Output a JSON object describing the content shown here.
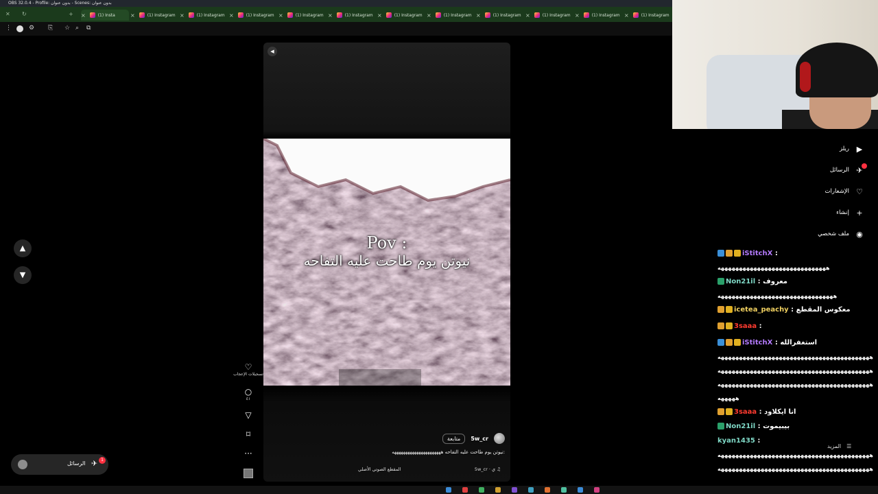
{
  "obs_title": "OBS 32.0.4 - Profile: بدون عنوان - Scenes: بدون عنوان",
  "tabs": [
    {
      "label": "(1) Insta"
    },
    {
      "label": "(1) Instagram"
    },
    {
      "label": "(1) Instagram"
    },
    {
      "label": "(1) Instagram"
    },
    {
      "label": "(1) Instagram"
    },
    {
      "label": "(1) Instagram"
    },
    {
      "label": "(1) Instagram"
    },
    {
      "label": "(1) Instagram"
    },
    {
      "label": "(1) Instagram"
    },
    {
      "label": "(1) Instagram"
    },
    {
      "label": "(1) Instagram"
    },
    {
      "label": "(1) Instagram"
    },
    {
      "label": "(1) Instagram"
    }
  ],
  "reel": {
    "overlay_line1": "Pov :",
    "overlay_line2": "نيوتن يوم طاحت عليه التفاحه",
    "username": "5w_cr",
    "follow_label": "متابعة",
    "caption": "نيوتن يوم طاحت عليه التفاحه ههههههههههههههههههههههه:",
    "audio_user": "5w_cr · ي",
    "audio_label": "المقطع الصوتي الأصلي",
    "likes_label": "تسجيلات الإعجاب",
    "comments_count": "٤١"
  },
  "messages_pill": {
    "label": "الرسائل",
    "badge": "1"
  },
  "ig_sidebar": [
    {
      "label": "ريلز",
      "icon": "reels-icon"
    },
    {
      "label": "الرسائل",
      "icon": "messages-icon"
    },
    {
      "label": "الإشعارات",
      "icon": "heart-icon"
    },
    {
      "label": "إنشاء",
      "icon": "plus-icon"
    },
    {
      "label": "ملف شخصي",
      "icon": "profile-icon"
    }
  ],
  "chat": [
    {
      "user": "iStitchX",
      "color": "#b57bff",
      "badges": [
        "#3a8fd8",
        "#e0a030",
        "#e0b020"
      ],
      "msg": ""
    },
    {
      "user": "",
      "color": "#ffffff",
      "badges": [],
      "msg": "ههههههههههههههههههههههههههههههه"
    },
    {
      "user": "Non21il",
      "color": "#7fd8c6",
      "badges": [
        "#2aa06a"
      ],
      "msg": "معروف"
    },
    {
      "user": "",
      "color": "#ffffff",
      "badges": [],
      "msg": "ههههههههههههههههههههههههههههههههه"
    },
    {
      "user": "icetea_peachy",
      "color": "#f0d060",
      "badges": [
        "#e0a030",
        "#e0b020"
      ],
      "msg": "معكوس المقطع"
    },
    {
      "user": "3saaa",
      "color": "#ff3b30",
      "badges": [
        "#e0a030",
        "#e0b020"
      ],
      "msg": ""
    },
    {
      "user": "iStitchX",
      "color": "#b57bff",
      "badges": [
        "#3a8fd8",
        "#e0a030",
        "#e0b020"
      ],
      "msg": "استغفرالله"
    },
    {
      "user": "",
      "color": "#ffffff",
      "badges": [],
      "msg": "ههههههههههههههههههههههههههههههههههههههههههه"
    },
    {
      "user": "",
      "color": "#ffffff",
      "badges": [],
      "msg": "ههههههههههههههههههههههههههههههههههههههههههه"
    },
    {
      "user": "",
      "color": "#ffffff",
      "badges": [],
      "msg": "ههههههههههههههههههههههههههههههههههههههههههه"
    },
    {
      "user": "",
      "color": "#ffffff",
      "badges": [],
      "msg": "هههههه"
    },
    {
      "user": "3saaa",
      "color": "#ff3b30",
      "badges": [
        "#e0a030",
        "#e0b020"
      ],
      "msg": "انا ايكلاود"
    },
    {
      "user": "Non21il",
      "color": "#7fd8c6",
      "badges": [
        "#2aa06a"
      ],
      "msg": "بيبيموت"
    },
    {
      "user": "kyan1435",
      "color": "#7fd8c6",
      "badges": [],
      "msg": ""
    },
    {
      "user": "",
      "color": "#ffffff",
      "badges": [],
      "msg": "ههههههههههههههههههههههههههههههههههههههههههه"
    },
    {
      "user": "",
      "color": "#ffffff",
      "badges": [],
      "msg": "ههههههههههههههههههههههههههههههههههههههههههه"
    }
  ],
  "more_label": "المزيد",
  "colors": {
    "accent_red": "#ff3040",
    "tabstrip": "#1b3a1c"
  }
}
